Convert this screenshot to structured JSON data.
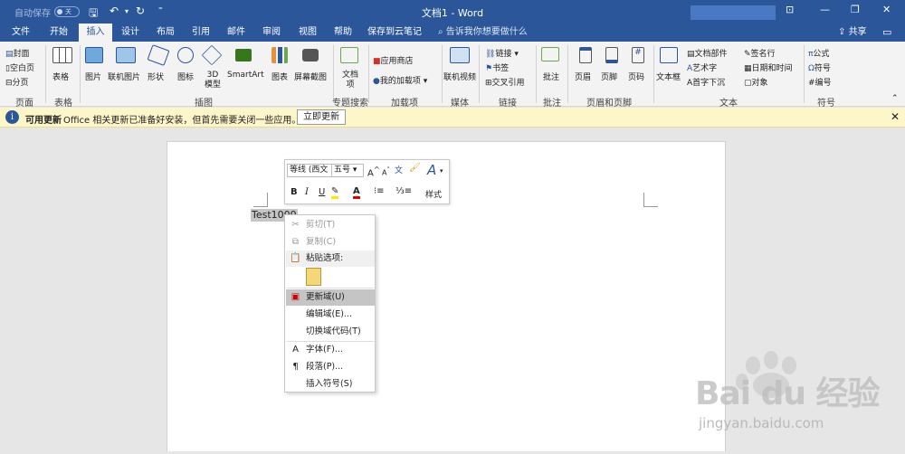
{
  "titlebar": {
    "autosave": "自动保存",
    "toggle": "关",
    "title": "文档1 - Word"
  },
  "tabs": [
    "文件",
    "开始",
    "插入",
    "设计",
    "布局",
    "引用",
    "邮件",
    "审阅",
    "视图",
    "帮助",
    "保存到云笔记"
  ],
  "tell_me": "告诉我你想要做什么",
  "share": "共享",
  "ribbon": {
    "pages": {
      "items": [
        "封面",
        "空白页",
        "分页"
      ],
      "label": "页面"
    },
    "tables": {
      "item": "表格",
      "label": "表格"
    },
    "illustrations": {
      "items": [
        "图片",
        "联机图片",
        "形状",
        "图标",
        "3D 模型",
        "SmartArt",
        "图表",
        "屏幕截图"
      ],
      "label": "插图"
    },
    "special": {
      "item": "文档项",
      "label": "专题搜索"
    },
    "addins": {
      "items": [
        "应用商店",
        "我的加载项"
      ],
      "label": "加载项"
    },
    "media": {
      "item": "联机视频",
      "label": "媒体"
    },
    "links": {
      "items": [
        "链接",
        "书签",
        "交叉引用"
      ],
      "label": "链接"
    },
    "comments": {
      "item": "批注",
      "label": "批注"
    },
    "header_footer": {
      "items": [
        "页眉",
        "页脚",
        "页码"
      ],
      "label": "页眉和页脚"
    },
    "text": {
      "items": [
        "文本框",
        "文档部件",
        "艺术字",
        "首字下沉",
        "签名行",
        "日期和时间",
        "对象"
      ],
      "label": "文本"
    },
    "symbols": {
      "items": [
        "公式",
        "符号",
        "编号"
      ],
      "label": "符号"
    }
  },
  "infobar": {
    "title": "可用更新",
    "message": "Office 相关更新已准备好安装，但首先需要关闭一些应用。",
    "button": "立即更新"
  },
  "document": {
    "selected_text": "Test1000"
  },
  "minibar": {
    "font": "等线 (西文",
    "size": "五号",
    "styles": "样式",
    "bold": "B",
    "italic": "I",
    "underline": "U"
  },
  "context_menu": {
    "cut": "剪切(T)",
    "copy": "复制(C)",
    "paste_options": "粘贴选项:",
    "update_field": "更新域(U)",
    "edit_field": "编辑域(E)...",
    "toggle_codes": "切换域代码(T)",
    "font": "字体(F)...",
    "paragraph": "段落(P)...",
    "insert_symbol": "插入符号(S)"
  },
  "watermark": {
    "brand": "Bai du 经验",
    "url": "jingyan.baidu.com"
  },
  "colors": {
    "word_blue": "#2b579a",
    "infobar": "#fdf6c8"
  }
}
